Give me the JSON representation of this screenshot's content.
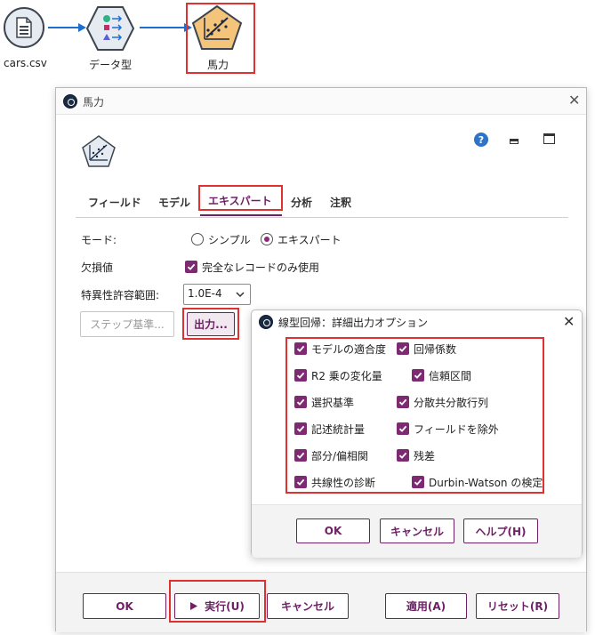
{
  "stream": {
    "nodes": [
      {
        "label": "cars.csv",
        "icon": "file-csv-icon"
      },
      {
        "label": "データ型",
        "icon": "type-node-icon"
      },
      {
        "label": "馬力",
        "icon": "regression-model-icon"
      }
    ]
  },
  "dialog": {
    "title": "馬力",
    "help_icon": "?",
    "tabs": [
      {
        "label": "フィールド"
      },
      {
        "label": "モデル"
      },
      {
        "label": "エキスパート"
      },
      {
        "label": "分析"
      },
      {
        "label": "注釈"
      }
    ],
    "mode_label": "モード:",
    "mode_simple": "シンプル",
    "mode_expert": "エキスパート",
    "missing_label": "欠損値",
    "missing_option": "完全なレコードのみ使用",
    "singularity_label": "特異性許容範囲:",
    "singularity_value": "1.0E-4",
    "step_button": "ステップ基準...",
    "output_button": "出力...",
    "footer": {
      "ok": "OK",
      "run": "実行(U)",
      "cancel": "キャンセル",
      "apply": "適用(A)",
      "reset": "リセット(R)"
    }
  },
  "subdialog": {
    "title": "線型回帰：詳細出力オプション",
    "options": [
      {
        "label": "モデルの適合度",
        "checked": true
      },
      {
        "label": "回帰係数",
        "checked": true
      },
      {
        "label": "R2 乗の変化量",
        "checked": true
      },
      {
        "label": "信頼区間",
        "checked": true
      },
      {
        "label": "選択基準",
        "checked": true
      },
      {
        "label": "分散共分散行列",
        "checked": true
      },
      {
        "label": "記述統計量",
        "checked": true
      },
      {
        "label": "フィールドを除外",
        "checked": true
      },
      {
        "label": "部分/偏相関",
        "checked": true
      },
      {
        "label": "残差",
        "checked": true
      },
      {
        "label": "共線性の診断",
        "checked": true
      },
      {
        "label": "Durbin-Watson の検定",
        "checked": true
      }
    ],
    "buttons": {
      "ok": "OK",
      "cancel": "キャンセル",
      "help": "ヘルプ(H)"
    }
  },
  "colors": {
    "accent": "#6e1f66",
    "highlight": "#e03131",
    "link_arrow": "#1f6fd1"
  }
}
